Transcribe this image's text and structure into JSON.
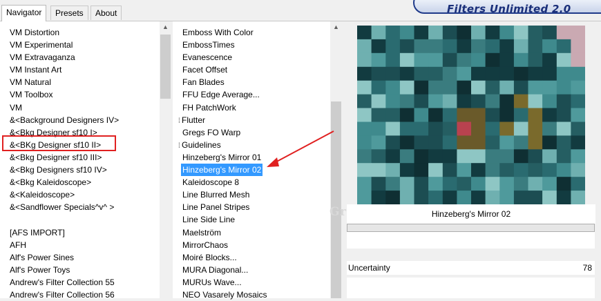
{
  "tabs": [
    {
      "label": "Navigator",
      "active": true
    },
    {
      "label": "Presets",
      "active": false
    },
    {
      "label": "About",
      "active": false
    }
  ],
  "logo_text": "Filters Unlimited 2.0",
  "categories": [
    "VM Distortion",
    "VM Experimental",
    "VM Extravaganza",
    "VM Instant Art",
    "VM Natural",
    "VM Toolbox",
    "VM",
    "&<Background Designers IV>",
    "&<Bkg Designer sf10 I>",
    "&<BKg Designer sf10 II>",
    "&<Bkg Designer sf10 III>",
    "&<Bkg Designers sf10 IV>",
    "&<Bkg Kaleidoscope>",
    "&<Kaleidoscope>",
    "&<Sandflower Specials^v^ >",
    "",
    "[AFS IMPORT]",
    "AFH",
    "Alf's Power Sines",
    "Alf's Power Toys",
    "Andrew's Filter Collection 55",
    "Andrew's Filter Collection 56"
  ],
  "filters": [
    {
      "label": "Emboss With Color"
    },
    {
      "label": "EmbossTimes"
    },
    {
      "label": "Evanescence"
    },
    {
      "label": "Facet Offset"
    },
    {
      "label": "Fan Blades"
    },
    {
      "label": "FFU Edge Average..."
    },
    {
      "label": "FH PatchWork"
    },
    {
      "label": "Flutter",
      "grip": true
    },
    {
      "label": "Gregs FO Warp"
    },
    {
      "label": "Guidelines",
      "grip": true
    },
    {
      "label": "Hinzeberg's Mirror 01"
    },
    {
      "label": "Hinzeberg's Mirror 02",
      "selected": true
    },
    {
      "label": "Kaleidoscope 8"
    },
    {
      "label": "Line Blurred Mesh"
    },
    {
      "label": "Line Panel Stripes"
    },
    {
      "label": "Line Side Line"
    },
    {
      "label": "Maelström"
    },
    {
      "label": "MirrorChaos"
    },
    {
      "label": "Moiré Blocks..."
    },
    {
      "label": "MURA Diagonal..."
    },
    {
      "label": "MURUs Wave..."
    },
    {
      "label": "NEO Vasarely Mosaics"
    }
  ],
  "grip_glyph": "⁞",
  "preview_filter_name": "Hinzeberg's Mirror 02",
  "watermark": "Grafitamia",
  "parameter": {
    "name": "Uncertainty",
    "value": "78"
  },
  "colors": {
    "selection": "#3399ff",
    "highlight_box": "#e02020",
    "arrow": "#e02020",
    "preview_base": "#1e5458"
  }
}
